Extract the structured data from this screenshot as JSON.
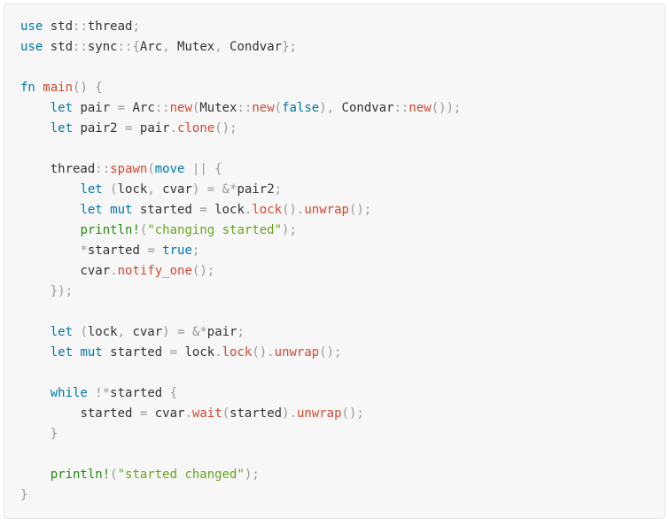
{
  "code": {
    "l1_use": "use",
    "l1_path": " std",
    "l1_sep": "::",
    "l1_thread": "thread",
    "l1_semi": ";",
    "l2_use": "use",
    "l2_path": " std",
    "l2_sep1": "::",
    "l2_sync": "sync",
    "l2_sep2": "::",
    "l2_brace_o": "{",
    "l2_arc": "Arc",
    "l2_c1": ", ",
    "l2_mutex": "Mutex",
    "l2_c2": ", ",
    "l2_condvar": "Condvar",
    "l2_brace_c": "}",
    "l2_semi": ";",
    "l4_fn": "fn",
    "l4_main": " main",
    "l4_paren": "()",
    "l4_brace": " {",
    "l5_let": "let",
    "l5_pair": " pair ",
    "l5_eq": "=",
    "l5_arc": " Arc",
    "l5_sep1": "::",
    "l5_new1": "new",
    "l5_p1": "(",
    "l5_mutex": "Mutex",
    "l5_sep2": "::",
    "l5_new2": "new",
    "l5_p2": "(",
    "l5_false": "false",
    "l5_p3": ")",
    "l5_c": ", ",
    "l5_cv": "Condvar",
    "l5_sep3": "::",
    "l5_new3": "new",
    "l5_p4": "())",
    "l5_semi": ";",
    "l6_let": "let",
    "l6_pair2": " pair2 ",
    "l6_eq": "=",
    "l6_rest": " pair",
    "l6_dot": ".",
    "l6_clone": "clone",
    "l6_paren": "()",
    "l6_semi": ";",
    "l8_thread": "thread",
    "l8_sep": "::",
    "l8_spawn": "spawn",
    "l8_p1": "(",
    "l8_move": "move",
    "l8_bars": " || {",
    "l9_let": "let",
    "l9_p1": " (",
    "l9_lock": "lock",
    "l9_c": ", ",
    "l9_cvar": "cvar",
    "l9_p2": ") ",
    "l9_eq": "=",
    "l9_amp": " &*",
    "l9_pair2": "pair2",
    "l9_semi": ";",
    "l10_let": "let",
    "l10_mut": " mut",
    "l10_started": " started ",
    "l10_eq": "=",
    "l10_lock": " lock",
    "l10_dot1": ".",
    "l10_lockfn": "lock",
    "l10_p1": "()",
    "l10_dot2": ".",
    "l10_unwrap": "unwrap",
    "l10_p2": "()",
    "l10_semi": ";",
    "l11_println": "println!",
    "l11_p1": "(",
    "l11_str": "\"changing started\"",
    "l11_p2": ")",
    "l11_semi": ";",
    "l12_star": "*",
    "l12_started": "started ",
    "l12_eq": "=",
    "l12_true": " true",
    "l12_semi": ";",
    "l13_cvar": "cvar",
    "l13_dot": ".",
    "l13_notify": "notify_one",
    "l13_p": "()",
    "l13_semi": ";",
    "l14_close": "})",
    "l14_semi": ";",
    "l16_let": "let",
    "l16_p1": " (",
    "l16_lock": "lock",
    "l16_c": ", ",
    "l16_cvar": "cvar",
    "l16_p2": ") ",
    "l16_eq": "=",
    "l16_amp": " &*",
    "l16_pair": "pair",
    "l16_semi": ";",
    "l17_let": "let",
    "l17_mut": " mut",
    "l17_started": " started ",
    "l17_eq": "=",
    "l17_lock": " lock",
    "l17_dot1": ".",
    "l17_lockfn": "lock",
    "l17_p1": "()",
    "l17_dot2": ".",
    "l17_unwrap": "unwrap",
    "l17_p2": "()",
    "l17_semi": ";",
    "l19_while": "while",
    "l19_not": " !*",
    "l19_started": "started ",
    "l19_brace": "{",
    "l20_started": "started ",
    "l20_eq": "=",
    "l20_cvar": " cvar",
    "l20_dot1": ".",
    "l20_wait": "wait",
    "l20_p1": "(",
    "l20_arg": "started",
    "l20_p2": ")",
    "l20_dot2": ".",
    "l20_unwrap": "unwrap",
    "l20_p3": "()",
    "l20_semi": ";",
    "l21_brace": "}",
    "l23_println": "println!",
    "l23_p1": "(",
    "l23_str": "\"started changed\"",
    "l23_p2": ")",
    "l23_semi": ";",
    "l24_brace": "}"
  }
}
